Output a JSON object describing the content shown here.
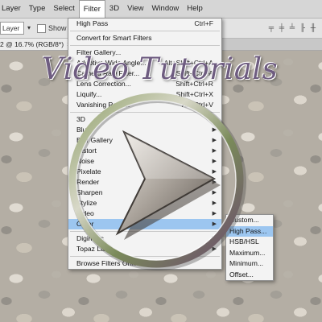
{
  "menubar": {
    "items": [
      "Layer",
      "Type",
      "Select",
      "Filter",
      "3D",
      "View",
      "Window",
      "Help"
    ]
  },
  "options": {
    "layer_select": "Layer",
    "show_transform": "Show Tran"
  },
  "doc_tab": {
    "title": "2 @ 16.7% (RGB/8*)",
    "close": "×"
  },
  "filter_menu": {
    "groups": [
      [
        {
          "label": "High Pass",
          "shortcut": "Ctrl+F"
        }
      ],
      [
        {
          "label": "Convert for Smart Filters",
          "shortcut": ""
        }
      ],
      [
        {
          "label": "Filter Gallery...",
          "shortcut": ""
        },
        {
          "label": "Adaptive Wide Angle...",
          "shortcut": "Alt+Shift+Ctrl+A"
        },
        {
          "label": "Camera Raw Filter...",
          "shortcut": "Shift+Ctrl+A"
        },
        {
          "label": "Lens Correction...",
          "shortcut": "Shift+Ctrl+R"
        },
        {
          "label": "Liquify...",
          "shortcut": "Shift+Ctrl+X"
        },
        {
          "label": "Vanishing Point...",
          "shortcut": "Alt+Ctrl+V"
        }
      ],
      [
        {
          "label": "3D",
          "submenu": true
        },
        {
          "label": "Blur",
          "submenu": true
        },
        {
          "label": "Blur Gallery",
          "submenu": true
        },
        {
          "label": "Distort",
          "submenu": true
        },
        {
          "label": "Noise",
          "submenu": true
        },
        {
          "label": "Pixelate",
          "submenu": true
        },
        {
          "label": "Render",
          "submenu": true
        },
        {
          "label": "Sharpen",
          "submenu": true
        },
        {
          "label": "Stylize",
          "submenu": true
        },
        {
          "label": "Video",
          "submenu": true
        },
        {
          "label": "Other",
          "submenu": true,
          "highlighted": true
        }
      ],
      [
        {
          "label": "Digimarc",
          "submenu": true
        },
        {
          "label": "Topaz Labs",
          "submenu": true
        }
      ],
      [
        {
          "label": "Browse Filters Online...",
          "shortcut": ""
        }
      ]
    ]
  },
  "other_submenu": {
    "items": [
      {
        "label": "Custom..."
      },
      {
        "label": "High Pass...",
        "highlighted": true
      },
      {
        "label": "HSB/HSL"
      },
      {
        "label": "Maximum..."
      },
      {
        "label": "Minimum..."
      },
      {
        "label": "Offset..."
      }
    ]
  },
  "overlay": {
    "title": "Video Tutorials",
    "icon": "play-icon"
  },
  "colors": {
    "highlight": "#9cc6f0",
    "title": "#6e5c80"
  }
}
